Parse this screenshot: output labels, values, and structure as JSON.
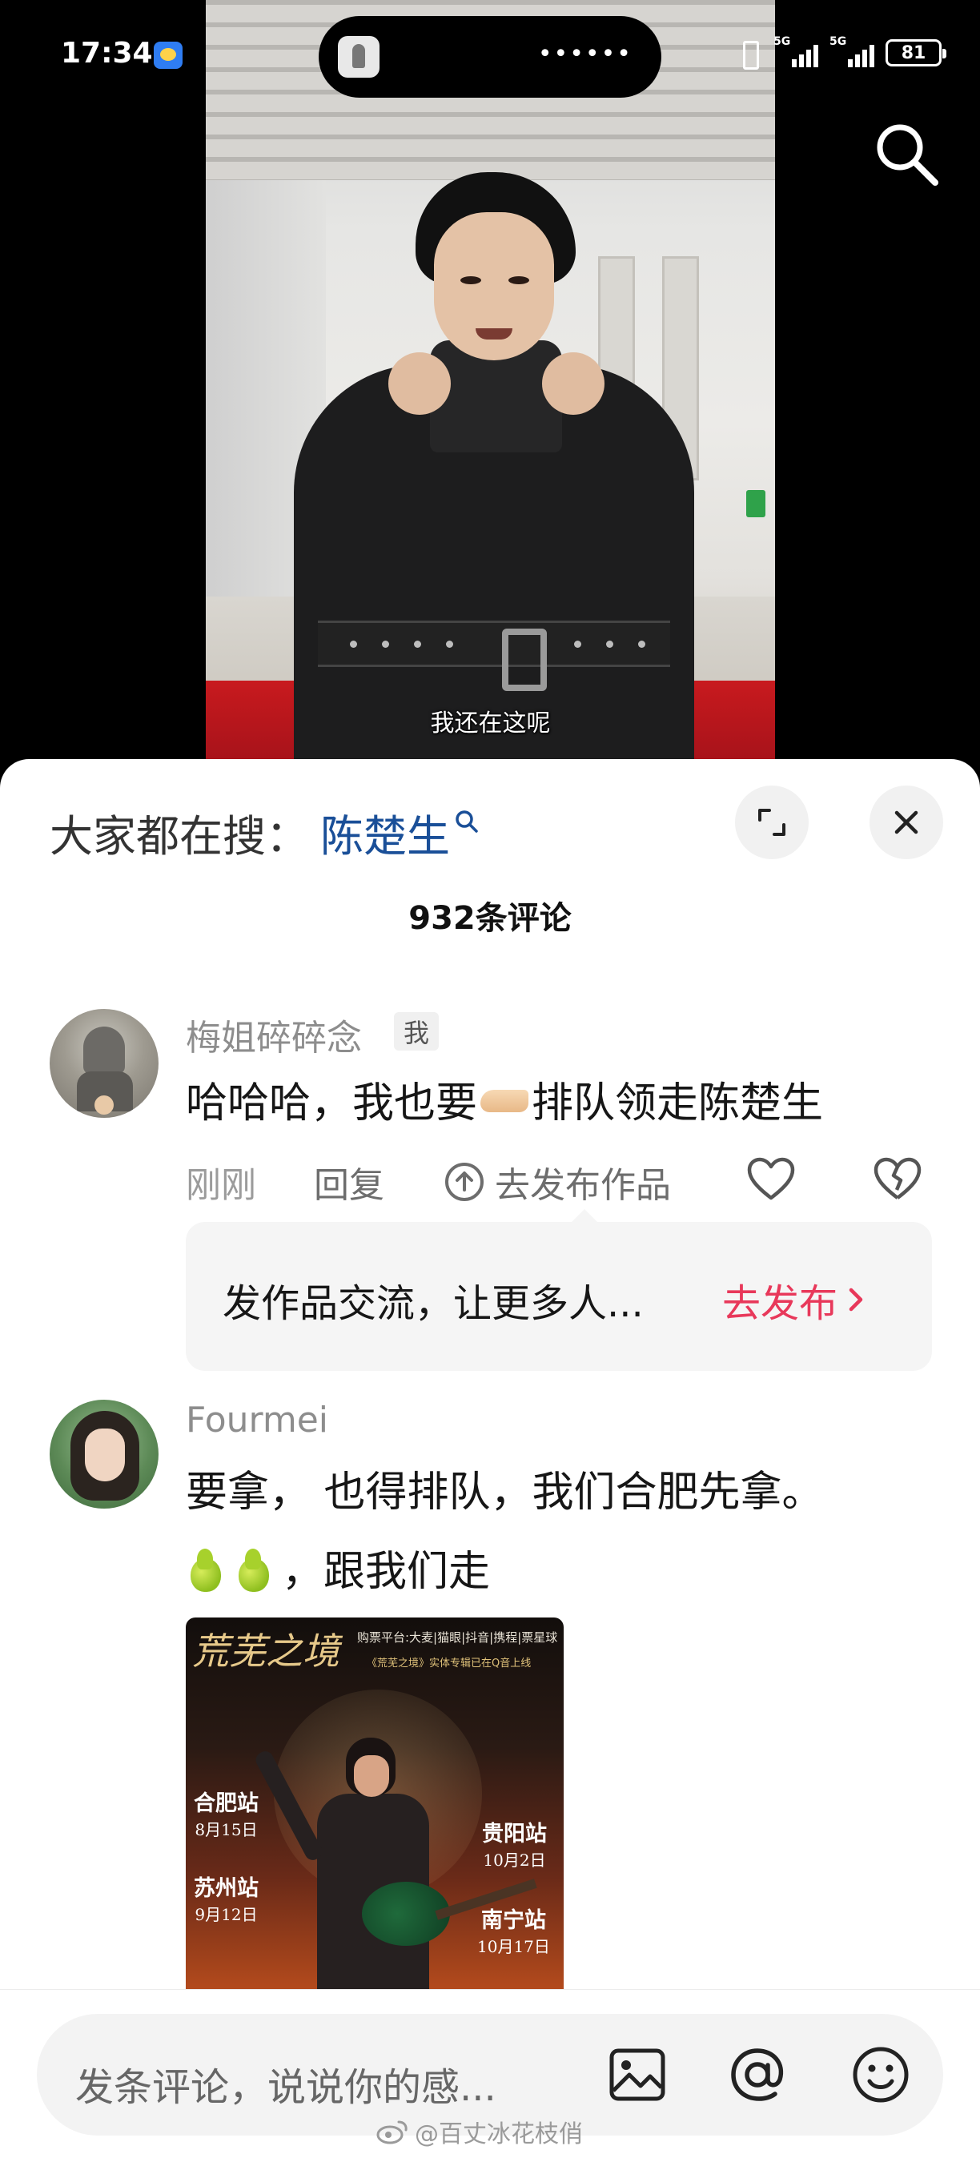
{
  "status_bar": {
    "time": "17:34",
    "signal_1_label": "5G",
    "signal_2_label": "5G",
    "battery": "81",
    "island_dots": "••••••"
  },
  "video": {
    "subtitle": "我还在这呢"
  },
  "sheet": {
    "trending_prefix": "大家都在搜：",
    "trending_term": "陈楚生",
    "comment_count_title": "932条评论"
  },
  "comments": [
    {
      "username": "梅姐碎碎念",
      "badge": "我",
      "text_before_emoji": "哈哈哈，我也要",
      "emoji": "hand-emoji",
      "text_after_emoji": "排队领走陈楚生",
      "time": "刚刚",
      "reply_label": "回复",
      "publish_label": "去发布作品",
      "promo_text": "发作品交流，让更多人...",
      "promo_link": "去发布"
    },
    {
      "username": "Fourmei",
      "line1": "要拿， 也得排队，我们合肥先拿。",
      "line2_emoji": "pear-emoji",
      "line2_text": "，跟我们走",
      "poster": {
        "logo": "荒芜之境",
        "info": "购票平台:大麦|猫眼|抖音|携程|票星球",
        "info2": "《荒芜之境》实体专辑已在Q音上线",
        "stops": [
          {
            "city": "合肥站",
            "date": "8月15日"
          },
          {
            "city": "苏州站",
            "date": "9月12日"
          },
          {
            "city": "贵阳站",
            "date": "10月2日"
          },
          {
            "city": "南宁站",
            "date": "10月17日"
          }
        ]
      }
    }
  ],
  "input_bar": {
    "placeholder": "发条评论，说说你的感..."
  },
  "watermark": "@百丈冰花枝俏",
  "colors": {
    "trending_term": "#1a4f98",
    "promo_link": "#e8385a",
    "sheet_bg": "#ffffff"
  },
  "icons": [
    "search-icon",
    "expand-icon",
    "close-icon",
    "publish-upload-icon",
    "heart-icon",
    "broken-heart-icon",
    "chevron-right-icon",
    "image-icon",
    "at-icon",
    "emoji-face-icon"
  ]
}
